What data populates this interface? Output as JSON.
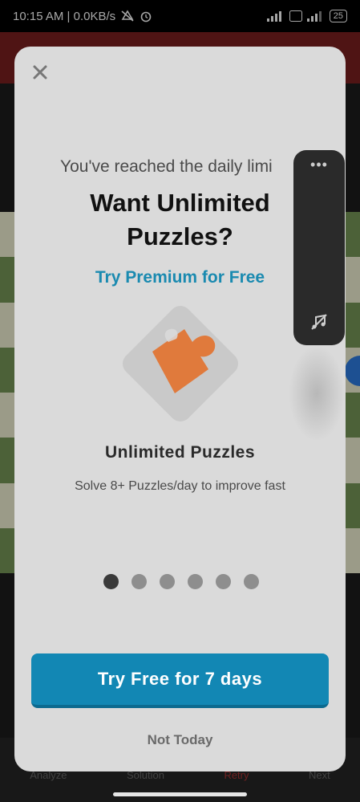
{
  "status_bar": {
    "time": "10:15 AM",
    "net_speed": "0.0KB/s",
    "battery": "25",
    "icons": [
      "mute-icon",
      "alarm-icon",
      "signal-icon",
      "volte-icon",
      "battery-icon"
    ]
  },
  "modal": {
    "close_icon": "close-icon",
    "daily_limit_text": "You've reached the daily limi",
    "headline": "Want Unlimited Puzzles?",
    "premium_link": "Try Premium for Free",
    "feature_icon": "puzzle-piece-icon",
    "feature_title": "Unlimited Puzzles",
    "feature_desc": "Solve 8+ Puzzles/day to improve fast",
    "page_count": 6,
    "active_page": 1,
    "cta_label": "Try Free for 7 days",
    "dismiss_label": "Not Today"
  },
  "side_panel": {
    "more_label": "•••",
    "music_icon": "music-off-icon"
  },
  "background": {
    "footer_items": [
      "Analyze",
      "Solution",
      "Retry",
      "Next"
    ]
  },
  "colors": {
    "accent": "#1287b4",
    "link": "#1a8ab0",
    "modal_bg": "#dadada",
    "puzzle_orange": "#e07a3c"
  }
}
